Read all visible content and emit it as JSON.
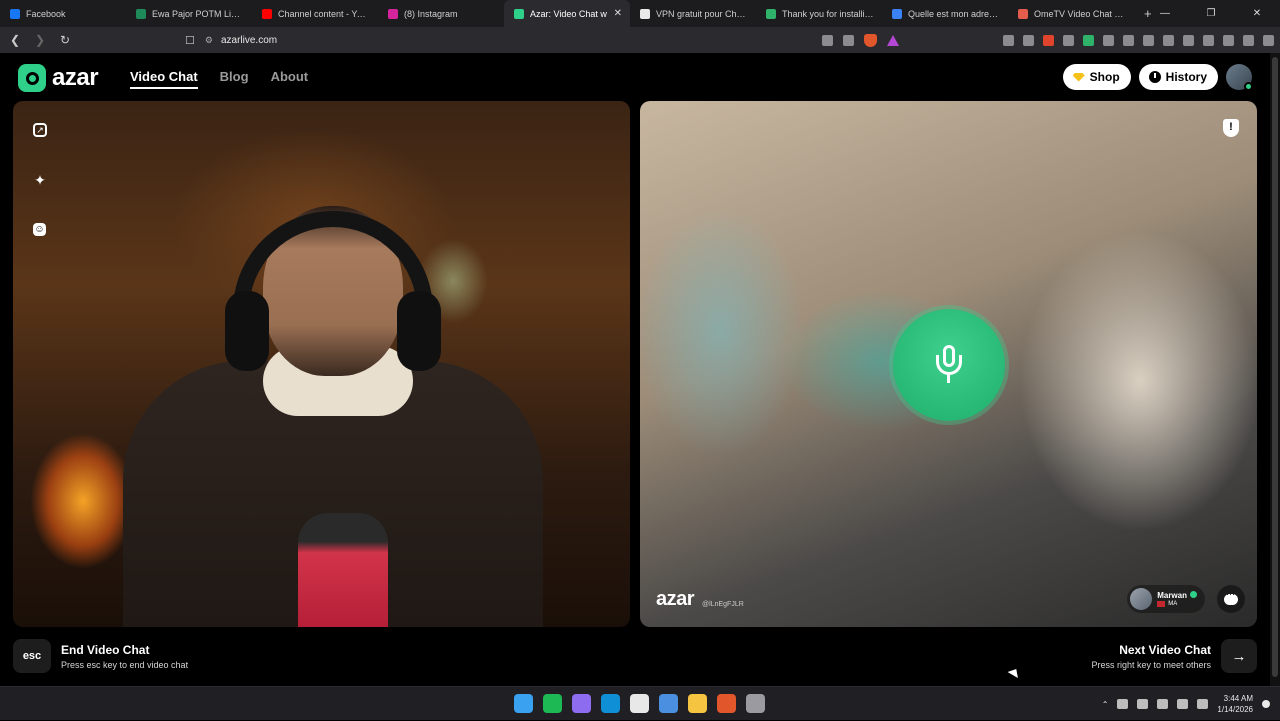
{
  "browser": {
    "tabs": [
      {
        "title": "Facebook",
        "color": "#1877f2",
        "active": false
      },
      {
        "title": "Ewa Pajor POTM Liga F EA",
        "color": "#1e8a5a",
        "active": false
      },
      {
        "title": "Channel content - YouTub",
        "color": "#ff0000",
        "active": false
      },
      {
        "title": "(8) Instagram",
        "color": "#d6249f",
        "active": false
      },
      {
        "title": "Azar: Video Chat w",
        "color": "#2fd18a",
        "active": true
      },
      {
        "title": "VPN gratuit pour Chrome",
        "color": "#e9e9e9",
        "active": false
      },
      {
        "title": "Thank you for installing V",
        "color": "#2fb36b",
        "active": false
      },
      {
        "title": "Quelle est mon adresse IP",
        "color": "#3b82f6",
        "active": false
      },
      {
        "title": "OmeTV Video Chat — Om",
        "color": "#e45c4b",
        "active": false
      }
    ],
    "close_tab": "✕",
    "new_tab": "+",
    "url": "azarlive.com",
    "window_controls": [
      "—",
      "❐",
      "✕"
    ]
  },
  "site": {
    "logo_text": "azar",
    "nav": [
      {
        "label": "Video Chat",
        "active": true
      },
      {
        "label": "Blog",
        "active": false
      },
      {
        "label": "About",
        "active": false
      }
    ],
    "shop_label": "Shop",
    "history_label": "History"
  },
  "remote": {
    "watermark": "azar",
    "user_id": "@lLnEgFJLR",
    "peer_name": "Marwan",
    "peer_country": "MA"
  },
  "controls": {
    "end_key": "esc",
    "end_title": "End Video Chat",
    "end_hint": "Press esc key to end video chat",
    "next_title": "Next Video Chat",
    "next_hint": "Press right key to meet others",
    "next_arrow": "→"
  },
  "taskbar": {
    "apps": [
      {
        "name": "windows-start",
        "color": "#3aa0f0"
      },
      {
        "name": "spotify",
        "color": "#1db954"
      },
      {
        "name": "copilot",
        "color": "#8e6cf0"
      },
      {
        "name": "edge",
        "color": "#0f8fd6"
      },
      {
        "name": "capcut",
        "color": "#e8e8e8"
      },
      {
        "name": "store",
        "color": "#4a8fe0"
      },
      {
        "name": "file-explorer",
        "color": "#f5c542"
      },
      {
        "name": "brave",
        "color": "#e2562c"
      },
      {
        "name": "settings",
        "color": "#9a9aa0"
      }
    ],
    "time": "3:44 AM",
    "date": "1/14/2026"
  },
  "colors": {
    "accent": "#2fd18a",
    "page_bg": "#000000",
    "mic_button": "#27bf79"
  }
}
